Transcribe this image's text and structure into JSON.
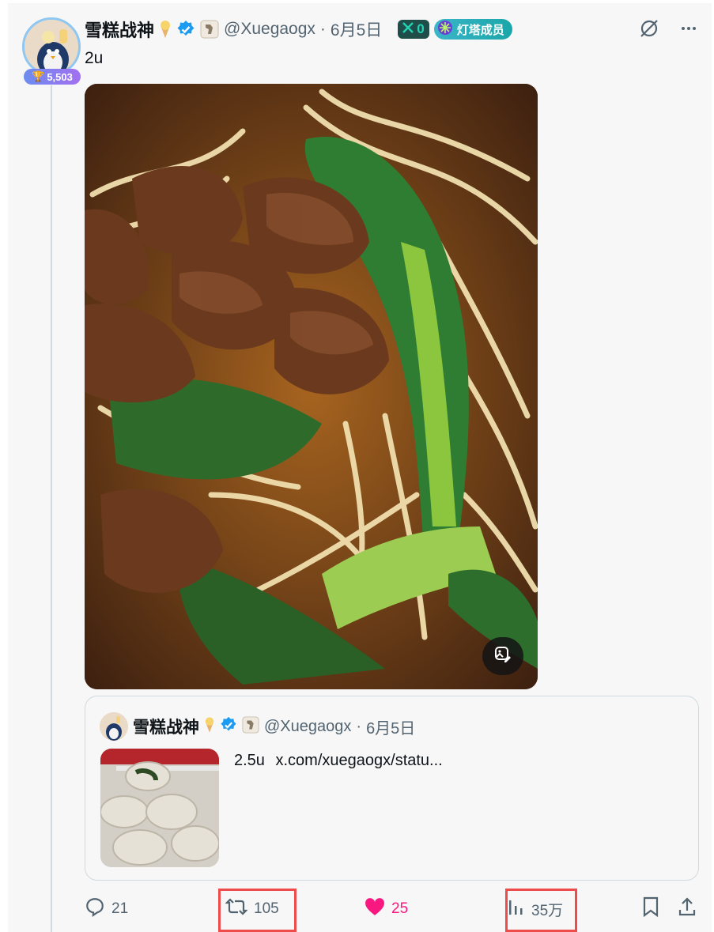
{
  "tweet": {
    "author": {
      "name": "雪糕战神",
      "handle": "@Xuegaogx",
      "date": "6月5日",
      "score": "5,503",
      "x_badge_count": "0",
      "member_badge": "灯塔成员"
    },
    "text": "2u",
    "photo_alt_icon": "edit-image-icon",
    "quote": {
      "name": "雪糕战神",
      "handle": "@Xuegaogx",
      "date": "6月5日",
      "text": "2.5u",
      "link": "x.com/xuegaogx/statu..."
    },
    "actions": {
      "replies": "21",
      "reposts": "105",
      "likes": "25",
      "views": "35万"
    }
  },
  "colors": {
    "like": "#f91880",
    "verified": "#1d9bf0",
    "highlight": "#ee4b4b"
  }
}
